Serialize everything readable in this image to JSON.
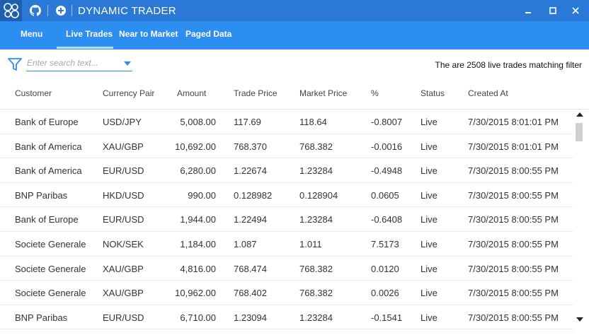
{
  "app": {
    "title": "DYNAMIC TRADER",
    "logo_text": "ξδ",
    "window_controls": {
      "minimize": "–",
      "maximize": "□",
      "close": "✕"
    },
    "colors": {
      "titlebar": "#2b79d6",
      "navbar": "#2d8ef2",
      "accent": "#2d8ef2"
    }
  },
  "nav": {
    "items": [
      {
        "label": "Menu"
      },
      {
        "label": "Live Trades"
      },
      {
        "label": "Near to Market"
      },
      {
        "label": "Paged Data"
      }
    ],
    "active": "Live Trades"
  },
  "filter": {
    "placeholder": "Enter search text...",
    "value": "",
    "icon": "filter-icon",
    "match_text": "The are 2508 live trades matching filter"
  },
  "table": {
    "columns": [
      "Customer",
      "Currency Pair",
      "Amount",
      "Trade Price",
      "Market Price",
      "%",
      "Status",
      "Created At"
    ],
    "rows": [
      [
        "Bank of Europe",
        "USD/JPY",
        "5,008.00",
        "117.69",
        "118.64",
        "-0.8007",
        "Live",
        "7/30/2015 8:01:01 PM"
      ],
      [
        "Bank of America",
        "XAU/GBP",
        "10,692.00",
        "768.370",
        "768.382",
        "-0.0016",
        "Live",
        "7/30/2015 8:01:01 PM"
      ],
      [
        "Bank of America",
        "EUR/USD",
        "6,280.00",
        "1.22674",
        "1.23284",
        "-0.4948",
        "Live",
        "7/30/2015 8:00:55 PM"
      ],
      [
        "BNP Paribas",
        "HKD/USD",
        "990.00",
        "0.128982",
        "0.128904",
        "0.0605",
        "Live",
        "7/30/2015 8:00:55 PM"
      ],
      [
        "Bank of Europe",
        "EUR/USD",
        "1,944.00",
        "1.22494",
        "1.23284",
        "-0.6408",
        "Live",
        "7/30/2015 8:00:55 PM"
      ],
      [
        "Societe Generale",
        "NOK/SEK",
        "1,184.00",
        "1.087",
        "1.011",
        "7.5173",
        "Live",
        "7/30/2015 8:00:55 PM"
      ],
      [
        "Societe Generale",
        "XAU/GBP",
        "4,816.00",
        "768.474",
        "768.382",
        "0.0120",
        "Live",
        "7/30/2015 8:00:55 PM"
      ],
      [
        "Societe Generale",
        "XAU/GBP",
        "10,962.00",
        "768.402",
        "768.382",
        "0.0026",
        "Live",
        "7/30/2015 8:00:55 PM"
      ],
      [
        "BNP Paribas",
        "EUR/USD",
        "6,710.00",
        "1.23094",
        "1.23284",
        "-0.1541",
        "Live",
        "7/30/2015 8:00:55 PM"
      ]
    ]
  }
}
